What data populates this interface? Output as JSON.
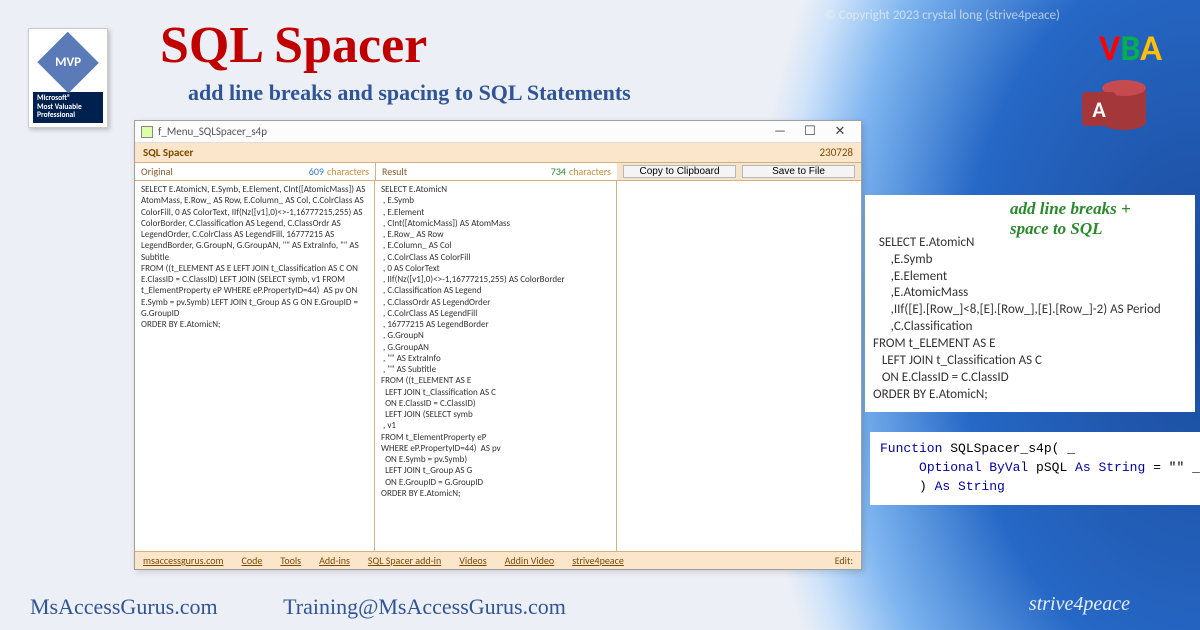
{
  "copyright": "© Copyright 2023 crystal long (strive4peace)",
  "mvp": {
    "diamond": "MVP",
    "label": "Microsoft®\nMost Valuable\nProfessional"
  },
  "title": "SQL Spacer",
  "subtitle": "add line breaks and spacing to SQL Statements",
  "vba_label": {
    "v": "V",
    "b": "B",
    "a": "A"
  },
  "access_icon_letter": "A",
  "window": {
    "title": "f_Menu_SQLSpacer_s4p",
    "min": "—",
    "max": "☐",
    "close": "✕",
    "header": {
      "name": "SQL Spacer",
      "version": "230728"
    },
    "cols": {
      "orig_label": "Original",
      "orig_count": "609",
      "res_label": "Result",
      "res_count": "734",
      "chars": "characters"
    },
    "buttons": {
      "copy": "Copy to Clipboard",
      "save": "Save to File"
    },
    "original_sql": "SELECT E.AtomicN, E.Symb, E.Element, CInt([AtomicMass]) AS AtomMass, E.Row_ AS Row, E.Column_ AS Col, C.ColrClass AS ColorFill, 0 AS ColorText, IIf(Nz([v1],0)<>-1,16777215,255) AS ColorBorder, C.Classification AS Legend, C.ClassOrdr AS LegendOrder, C.ColrClass AS LegendFill, 16777215 AS LegendBorder, G.GroupN, G.GroupAN, \"\" AS ExtraInfo, \"\" AS Subtitle\nFROM ((t_ELEMENT AS E LEFT JOIN t_Classification AS C ON E.ClassID = C.ClassID) LEFT JOIN (SELECT symb, v1 FROM t_ElementProperty eP WHERE eP.PropertyID=44)  AS pv ON E.Symb = pv.Symb) LEFT JOIN t_Group AS G ON E.GroupID = G.GroupID\nORDER BY E.AtomicN;",
    "result_sql": "SELECT E.AtomicN\n , E.Symb\n , E.Element\n , CInt([AtomicMass]) AS AtomMass\n , E.Row_ AS Row\n , E.Column_ AS Col\n , C.ColrClass AS ColorFill\n , 0 AS ColorText\n , IIf(Nz([v1],0)<>-1,16777215,255) AS ColorBorder\n , C.Classification AS Legend\n , C.ClassOrdr AS LegendOrder\n , C.ColrClass AS LegendFill\n , 16777215 AS LegendBorder\n , G.GroupN\n , G.GroupAN\n , \"\" AS ExtraInfo\n , \"\" AS Subtitle\nFROM ((t_ELEMENT AS E\n  LEFT JOIN t_Classification AS C\n  ON E.ClassID = C.ClassID)\n  LEFT JOIN (SELECT symb\n , v1\nFROM t_ElementProperty eP\nWHERE eP.PropertyID=44)  AS pv\n  ON E.Symb = pv.Symb)\n  LEFT JOIN t_Group AS G\n  ON E.GroupID = G.GroupID\nORDER BY E.AtomicN;",
    "footer": {
      "l1": "msaccessgurus.com",
      "l2": "Code",
      "l3": "Tools",
      "l4": "Add-ins",
      "l5": "SQL Spacer add-in",
      "l6": "Videos",
      "l7": "Addin Video",
      "l8": "strive4peace",
      "edit": "Edit:"
    }
  },
  "sql_box": {
    "note": "add line breaks +\nspace to SQL",
    "code": "SELECT E.AtomicN\n      ,E.Symb\n      ,E.Element\n      ,E.AtomicMass\n      ,IIf([E].[Row_]<8,[E].[Row_],[E].[Row_]-2) AS Period\n      ,C.Classification\nFROM t_ELEMENT AS E\n   LEFT JOIN t_Classification AS C\n   ON E.ClassID = C.ClassID\nORDER BY E.AtomicN;"
  },
  "vba_box": {
    "fn": "Function",
    "name": " SQLSpacer_s4p( _",
    "opt": "Optional ByVal",
    "param": " pSQL ",
    "as1": "As String",
    "eq": " = \"\" _",
    "close": "     ) ",
    "as2": "As String"
  },
  "bottom": {
    "site": "MsAccessGurus.com",
    "email": "Training@MsAccessGurus.com"
  },
  "strive": "strive4peace"
}
